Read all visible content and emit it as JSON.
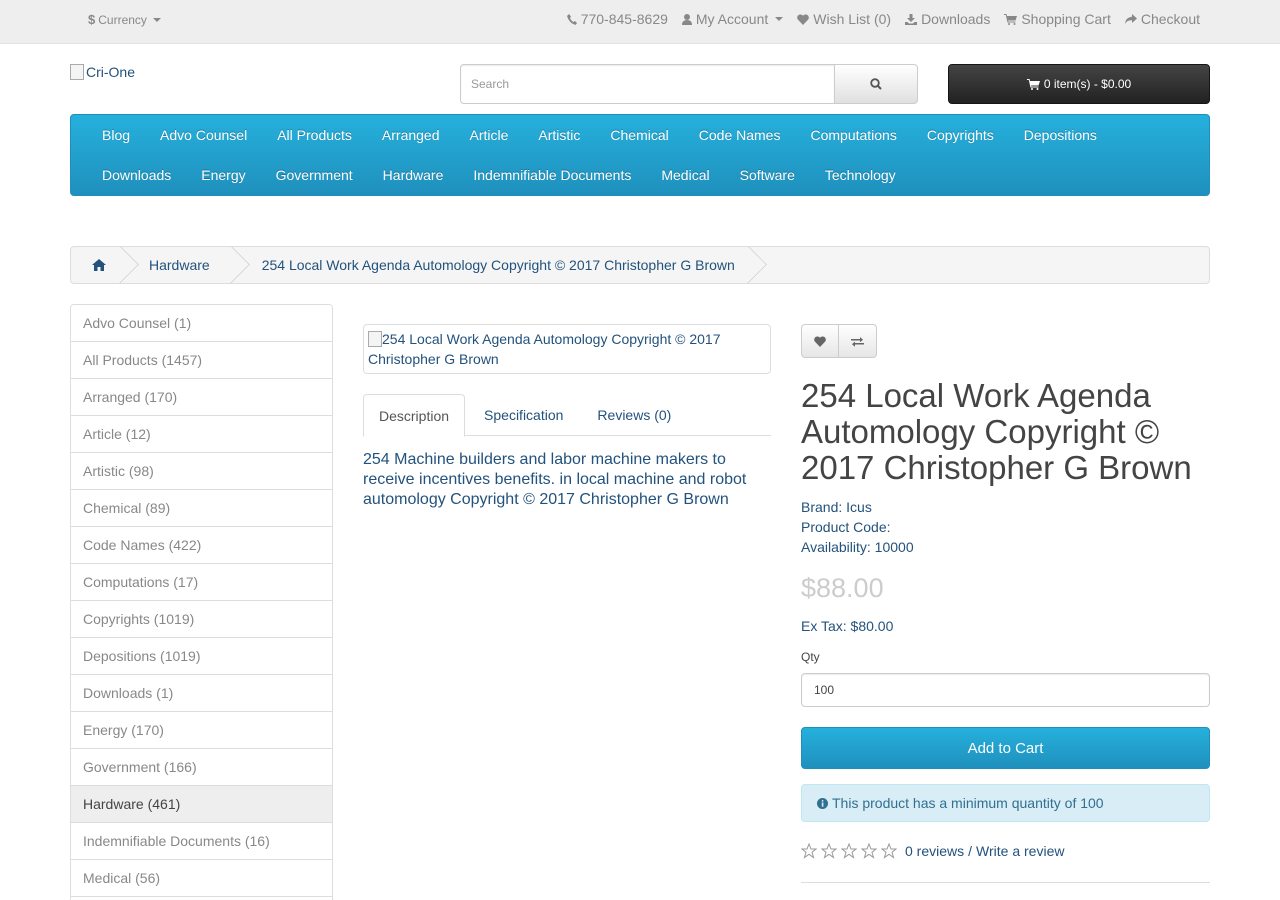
{
  "topbar": {
    "currency": "Currency",
    "phone": "770-845-8629",
    "my_account": "My Account",
    "wish_list": "Wish List (0)",
    "downloads": "Downloads",
    "shopping_cart": "Shopping Cart",
    "checkout": "Checkout"
  },
  "header": {
    "logo_alt": "Cri-One",
    "search_placeholder": "Search",
    "cart_button": "0 item(s) - $0.00"
  },
  "menu": {
    "row1": [
      "Blog",
      "Advo Counsel",
      "All Products",
      "Arranged",
      "Article",
      "Artistic",
      "Chemical",
      "Code Names",
      "Computations",
      "Copyrights",
      "Depositions"
    ],
    "row2": [
      "Downloads",
      "Energy",
      "Government",
      "Hardware",
      "Indemnifiable Documents",
      "Medical",
      "Software",
      "Technology"
    ]
  },
  "breadcrumb": {
    "items": [
      "Hardware",
      "254 Local Work Agenda Automology Copyright © 2017 Christopher G Brown"
    ]
  },
  "categories": [
    {
      "label": "Advo Counsel (1)",
      "active": false
    },
    {
      "label": "All Products (1457)",
      "active": false
    },
    {
      "label": "Arranged (170)",
      "active": false
    },
    {
      "label": "Article (12)",
      "active": false
    },
    {
      "label": "Artistic (98)",
      "active": false
    },
    {
      "label": "Chemical (89)",
      "active": false
    },
    {
      "label": "Code Names (422)",
      "active": false
    },
    {
      "label": "Computations (17)",
      "active": false
    },
    {
      "label": "Copyrights (1019)",
      "active": false
    },
    {
      "label": "Depositions (1019)",
      "active": false
    },
    {
      "label": "Downloads (1)",
      "active": false
    },
    {
      "label": "Energy (170)",
      "active": false
    },
    {
      "label": "Government (166)",
      "active": false
    },
    {
      "label": "Hardware (461)",
      "active": true
    },
    {
      "label": "Indemnifiable Documents (16)",
      "active": false
    },
    {
      "label": "Medical (56)",
      "active": false
    },
    {
      "label": "",
      "active": false
    }
  ],
  "product": {
    "image_alt": "254 Local Work Agenda Automology Copyright © 2017 Christopher G Brown",
    "tabs": [
      "Description",
      "Specification",
      "Reviews (0)"
    ],
    "description": "254 Machine builders and labor machine makers to receive incentives benefits. in local machine and robot automology Copyright © 2017 Christopher G Brown",
    "title": "254 Local Work Agenda Automology Copyright © 2017 Christopher G Brown",
    "brand_label": "Brand:",
    "brand": "Icus",
    "product_code_label": "Product Code:",
    "availability_label": "Availability:",
    "availability": "10000",
    "price": "$88.00",
    "ex_tax": "Ex Tax: $80.00",
    "qty_label": "Qty",
    "qty_value": "100",
    "add_to_cart": "Add to Cart",
    "min_qty_notice": "This product has a minimum quantity of 100",
    "reviews_link": "0 reviews",
    "separator": "/",
    "write_review": "Write a review",
    "rating": 0
  },
  "icons": {
    "topbar": [
      "phone-icon",
      "user-icon",
      "heart-icon",
      "download-icon",
      "cart-icon",
      "share-icon"
    ],
    "actions": [
      "heart-icon",
      "exchange-icon"
    ]
  }
}
